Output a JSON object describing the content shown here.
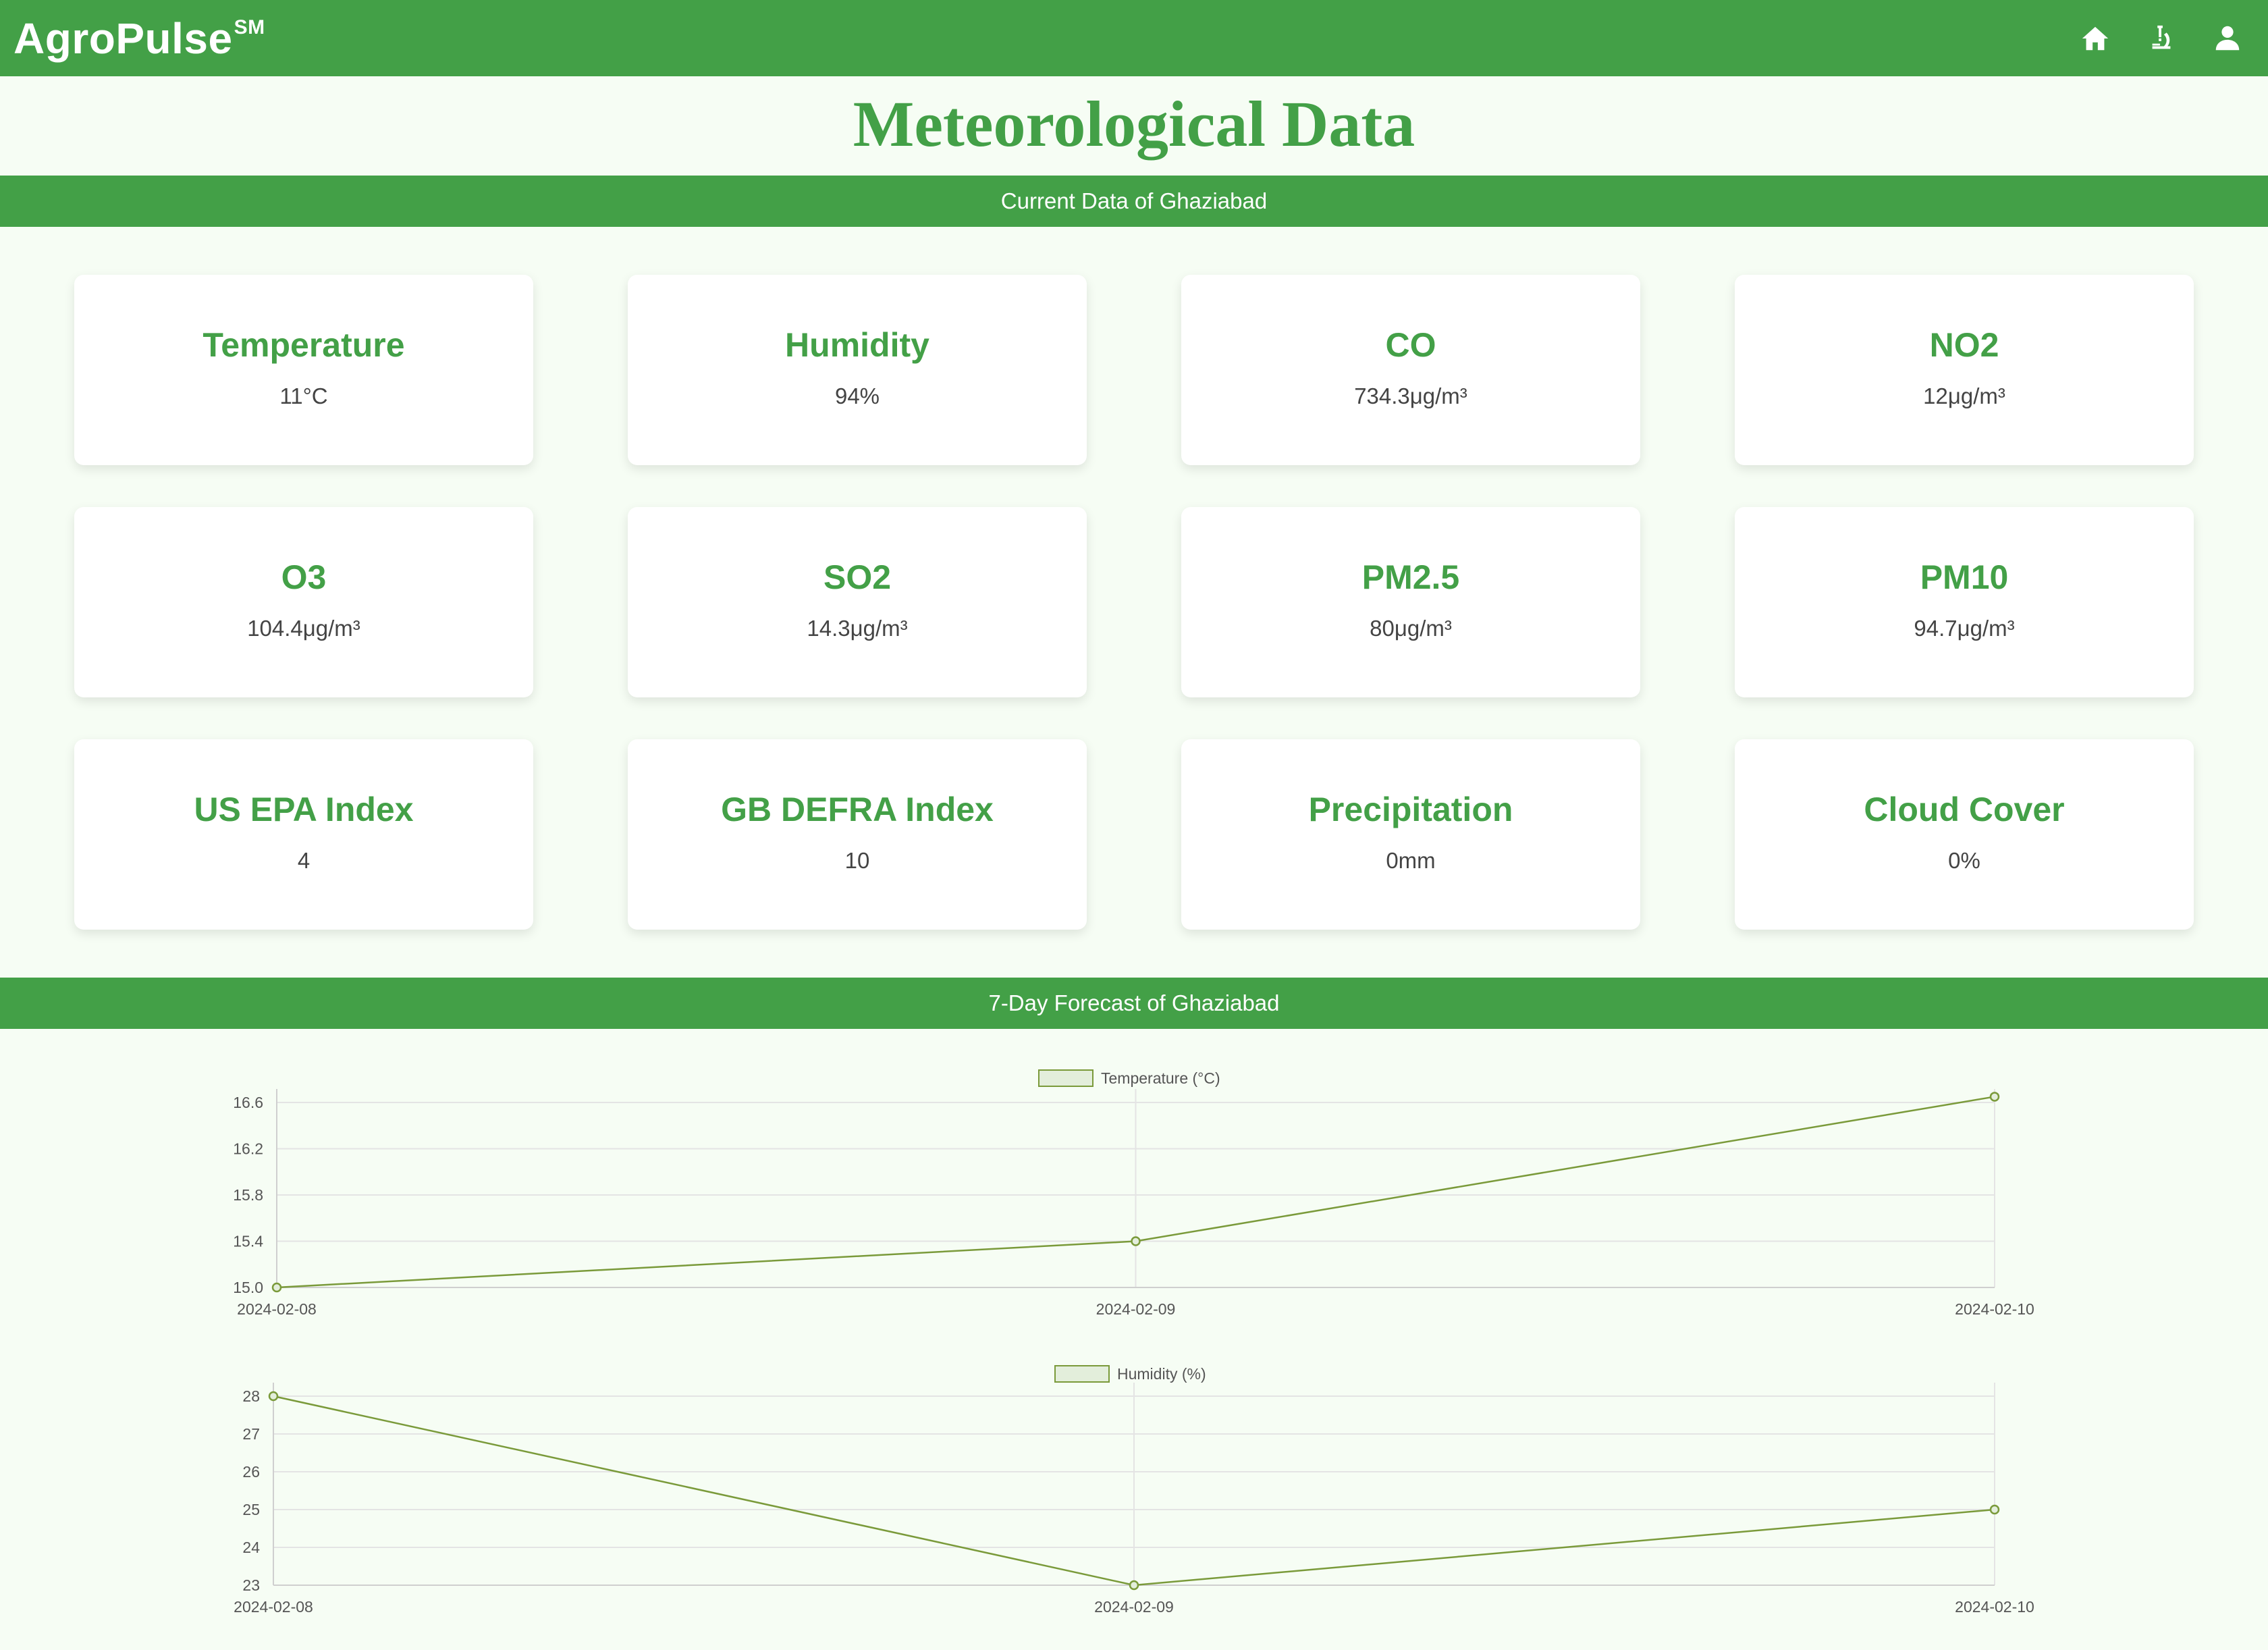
{
  "header": {
    "brand": "AgroPulse",
    "brand_mark": "SM",
    "nav": [
      {
        "name": "home-icon"
      },
      {
        "name": "microscope-icon"
      },
      {
        "name": "user-icon"
      }
    ]
  },
  "page_title": "Meteorological Data",
  "current_section_title": "Current Data of Ghaziabad",
  "metrics": [
    {
      "label": "Temperature",
      "value": "11°C"
    },
    {
      "label": "Humidity",
      "value": "94%"
    },
    {
      "label": "CO",
      "value": "734.3μg/m³"
    },
    {
      "label": "NO2",
      "value": "12μg/m³"
    },
    {
      "label": "O3",
      "value": "104.4μg/m³"
    },
    {
      "label": "SO2",
      "value": "14.3μg/m³"
    },
    {
      "label": "PM2.5",
      "value": "80μg/m³"
    },
    {
      "label": "PM10",
      "value": "94.7μg/m³"
    },
    {
      "label": "US EPA Index",
      "value": "4"
    },
    {
      "label": "GB DEFRA Index",
      "value": "10"
    },
    {
      "label": "Precipitation",
      "value": "0mm"
    },
    {
      "label": "Cloud Cover",
      "value": "0%"
    }
  ],
  "forecast_section_title": "7-Day Forecast of Ghaziabad",
  "colors": {
    "brand": "#43a047",
    "line": "#7a9a3a",
    "legend_fill": "#e3eedb"
  },
  "chart_data": [
    {
      "type": "line",
      "x": [
        "2024-02-08",
        "2024-02-09",
        "2024-02-10"
      ],
      "series": [
        {
          "name": "Temperature (°C)",
          "values": [
            15.0,
            15.4,
            16.65
          ]
        }
      ],
      "yticks": [
        "15.0",
        "15.4",
        "15.8",
        "16.2",
        "16.6"
      ],
      "ylim": [
        15.0,
        16.6
      ],
      "grid": true,
      "legend": "top-center"
    },
    {
      "type": "line",
      "x": [
        "2024-02-08",
        "2024-02-09",
        "2024-02-10"
      ],
      "series": [
        {
          "name": "Humidity (%)",
          "values": [
            28,
            23,
            25
          ]
        }
      ],
      "yticks": [
        "23",
        "24",
        "25",
        "26",
        "27",
        "28"
      ],
      "ylim": [
        23,
        28
      ],
      "grid": true,
      "legend": "top-center"
    }
  ]
}
